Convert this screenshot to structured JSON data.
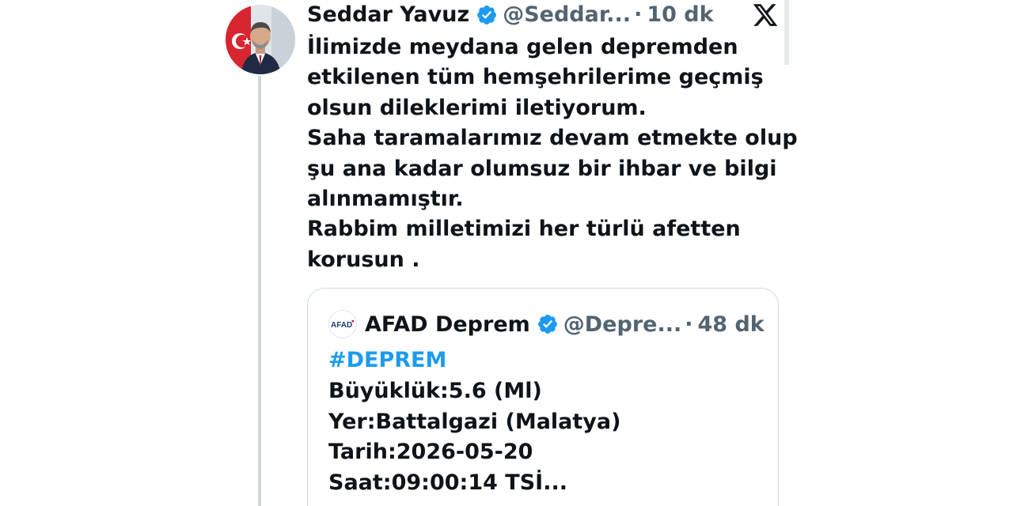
{
  "tweet": {
    "author_name": "Seddar Yavuz",
    "handle": "@Seddar...",
    "separator": "·",
    "time": "10 dk",
    "lines": [
      "İlimizde meydana gelen depremden",
      "etkilenen tüm hemşehrilerime geçmiş",
      "olsun dileklerimi iletiyorum.",
      "Saha taramalarımız devam etmekte olup",
      "şu ana kadar olumsuz bir ihbar ve bilgi",
      "alınmamıştır.",
      "Rabbim milletimizi her türlü afetten",
      "korusun ."
    ]
  },
  "quote": {
    "logo_text": "AFAD",
    "author_name": "AFAD Deprem",
    "handle": "@Depre...",
    "separator": "·",
    "time": "48 dk",
    "hashtag": "#DEPREM",
    "lines": [
      "Büyüklük:5.6 (Ml)",
      "Yer:Battalgazi (Malatya)",
      "Tarih:2026-05-20",
      "Saat:09:00:14 TSİ..."
    ]
  },
  "icons": {
    "verified": "verified-badge-icon",
    "platform": "x-logo-icon"
  },
  "colors": {
    "verified": "#1d9bf0",
    "hashtag": "#1d9bf0",
    "secondary_text": "#536471",
    "afad_red": "#d2232a",
    "afad_blue": "#1a3d7c"
  }
}
